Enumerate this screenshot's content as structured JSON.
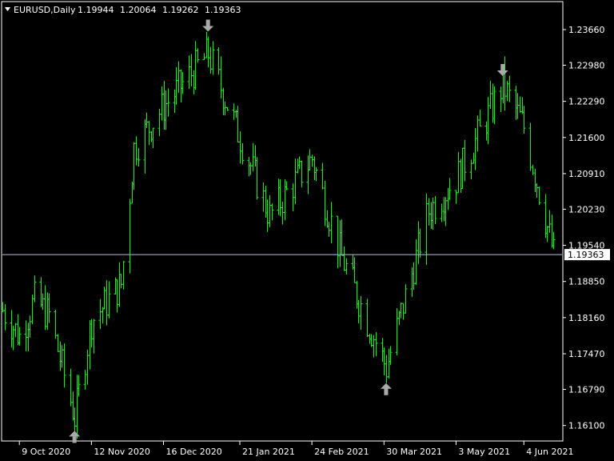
{
  "header": {
    "symbol": "EURUSD",
    "timeframe": "Daily",
    "symbol_label": "EURUSD,Daily",
    "open": "1.19944",
    "high": "1.20064",
    "low": "1.19262",
    "close": "1.19363"
  },
  "colors": {
    "background": "#000000",
    "frame": "#ffffff",
    "bar": "#00ff00",
    "arrow": "#a9a9a9",
    "bid_line": "#b0c4de"
  },
  "chart_data": {
    "type": "bar",
    "title": "EURUSD,Daily",
    "y_ticks": [
      "1.23660",
      "1.22980",
      "1.22290",
      "1.21600",
      "1.20910",
      "1.20230",
      "1.19540",
      "1.18850",
      "1.18160",
      "1.17470",
      "1.16790",
      "1.16100"
    ],
    "ylim": [
      1.1585,
      1.2395
    ],
    "x_ticks": [
      "9 Oct 2020",
      "12 Nov 2020",
      "16 Dec 2020",
      "21 Jan 2021",
      "24 Feb 2021",
      "30 Mar 2021",
      "3 May 2021",
      "4 Jun 2021"
    ],
    "current_price": "1.19363",
    "current_price_value": 1.19363,
    "signals": [
      {
        "type": "buy",
        "date": "4 Nov 2020",
        "price": 1.1612
      },
      {
        "type": "sell",
        "date": "6 Jan 2021",
        "price": 1.235
      },
      {
        "type": "buy",
        "date": "31 Mar 2021",
        "price": 1.1703
      },
      {
        "type": "sell",
        "date": "25 May 2021",
        "price": 1.2265
      }
    ],
    "price_path": [
      {
        "date": "1 Oct 2020",
        "price": 1.183
      },
      {
        "date": "9 Oct 2020",
        "price": 1.178
      },
      {
        "date": "16 Oct 2020",
        "price": 1.185
      },
      {
        "date": "23 Oct 2020",
        "price": 1.182
      },
      {
        "date": "4 Nov 2020",
        "price": 1.1625
      },
      {
        "date": "12 Nov 2020",
        "price": 1.181
      },
      {
        "date": "26 Nov 2020",
        "price": 1.188
      },
      {
        "date": "2 Dec 2020",
        "price": 1.214
      },
      {
        "date": "16 Dec 2020",
        "price": 1.222
      },
      {
        "date": "6 Jan 2021",
        "price": 1.232
      },
      {
        "date": "21 Jan 2021",
        "price": 1.216
      },
      {
        "date": "4 Feb 2021",
        "price": 1.201
      },
      {
        "date": "24 Feb 2021",
        "price": 1.212
      },
      {
        "date": "10 Mar 2021",
        "price": 1.193
      },
      {
        "date": "31 Mar 2021",
        "price": 1.172
      },
      {
        "date": "20 Apr 2021",
        "price": 1.202
      },
      {
        "date": "3 May 2021",
        "price": 1.208
      },
      {
        "date": "25 May 2021",
        "price": 1.226
      },
      {
        "date": "4 Jun 2021",
        "price": 1.218
      },
      {
        "date": "18 Jun 2021",
        "price": 1.1936
      }
    ]
  }
}
